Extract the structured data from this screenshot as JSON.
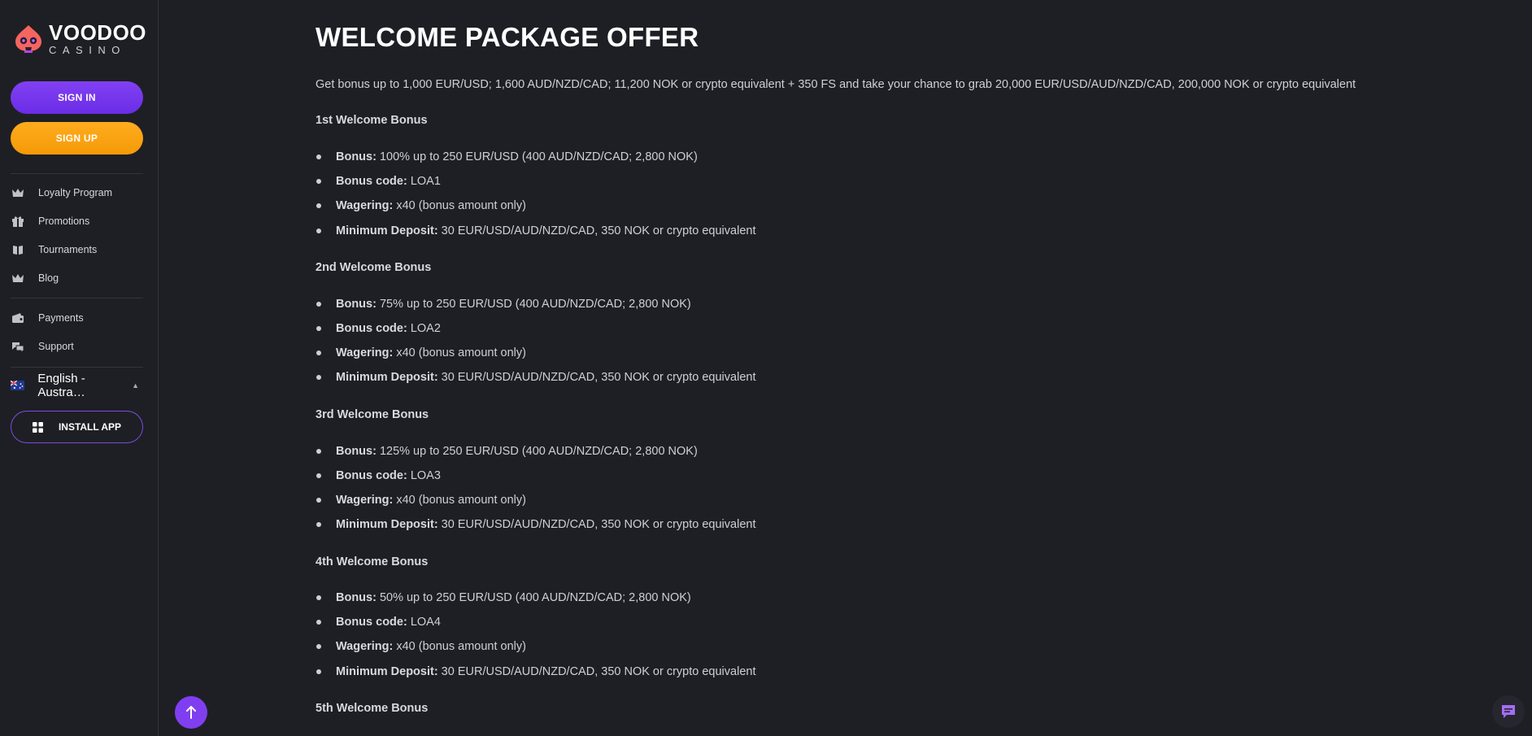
{
  "sidebar": {
    "logo": {
      "top": "VOODOO",
      "bottom": "CASINO"
    },
    "sign_in": "SIGN IN",
    "sign_up": "SIGN UP",
    "nav_primary": [
      {
        "label": "Loyalty Program",
        "icon": "crown-icon"
      },
      {
        "label": "Promotions",
        "icon": "gift-icon"
      },
      {
        "label": "Tournaments",
        "icon": "book-icon"
      },
      {
        "label": "Blog",
        "icon": "crown-icon"
      }
    ],
    "nav_secondary": [
      {
        "label": "Payments",
        "icon": "wallet-icon"
      },
      {
        "label": "Support",
        "icon": "chat-bubbles-icon"
      }
    ],
    "language": "English - Austra…",
    "install_app": "INSTALL APP"
  },
  "main": {
    "title": "WELCOME PACKAGE OFFER",
    "intro": "Get bonus up to 1,000 EUR/USD; 1,600 AUD/NZD/CAD; 11,200 NOK or crypto equivalent + 350 FS and take your chance to grab 20,000 EUR/USD/AUD/NZD/CAD, 200,000 NOK or crypto equivalent",
    "sections": [
      {
        "title": "1st Welcome Bonus",
        "items": [
          {
            "label": "Bonus:",
            "value": "100% up to 250 EUR/USD (400 AUD/NZD/CAD; 2,800 NOK)"
          },
          {
            "label": "Bonus code:",
            "value": "LOA1"
          },
          {
            "label": "Wagering:",
            "value": "x40 (bonus amount only)"
          },
          {
            "label": "Minimum Deposit:",
            "value": "30 EUR/USD/AUD/NZD/CAD, 350 NOK or crypto equivalent"
          }
        ]
      },
      {
        "title": "2nd Welcome Bonus",
        "items": [
          {
            "label": "Bonus:",
            "value": "75% up to 250 EUR/USD (400 AUD/NZD/CAD; 2,800 NOK)"
          },
          {
            "label": "Bonus code:",
            "value": "LOA2"
          },
          {
            "label": "Wagering:",
            "value": "x40 (bonus amount only)"
          },
          {
            "label": "Minimum Deposit:",
            "value": "30 EUR/USD/AUD/NZD/CAD, 350 NOK or crypto equivalent"
          }
        ]
      },
      {
        "title": "3rd Welcome Bonus",
        "items": [
          {
            "label": "Bonus:",
            "value": "125% up to 250 EUR/USD (400 AUD/NZD/CAD; 2,800 NOK)"
          },
          {
            "label": "Bonus code:",
            "value": "LOA3"
          },
          {
            "label": "Wagering:",
            "value": "x40 (bonus amount only)"
          },
          {
            "label": "Minimum Deposit:",
            "value": "30 EUR/USD/AUD/NZD/CAD, 350 NOK or crypto equivalent"
          }
        ]
      },
      {
        "title": "4th Welcome Bonus",
        "items": [
          {
            "label": "Bonus:",
            "value": "50% up to 250 EUR/USD (400 AUD/NZD/CAD; 2,800 NOK)"
          },
          {
            "label": "Bonus code:",
            "value": "LOA4"
          },
          {
            "label": "Wagering:",
            "value": "x40 (bonus amount only)"
          },
          {
            "label": "Minimum Deposit:",
            "value": "30 EUR/USD/AUD/NZD/CAD, 350 NOK or crypto equivalent"
          }
        ]
      },
      {
        "title": "5th Welcome Bonus",
        "items": []
      }
    ]
  },
  "colors": {
    "background": "#1e1f24",
    "accent_purple": "#7f3ff0",
    "accent_orange": "#f7a213"
  }
}
